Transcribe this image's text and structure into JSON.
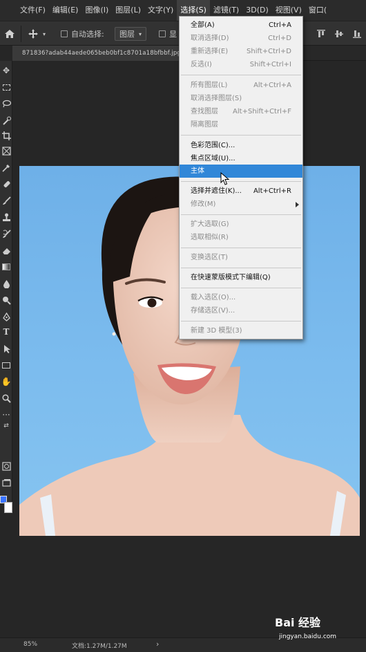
{
  "menubar": {
    "items": [
      "文件(F)",
      "编辑(E)",
      "图像(I)",
      "图层(L)",
      "文字(Y)",
      "选择(S)",
      "滤镜(T)",
      "3D(D)",
      "视图(V)",
      "窗口("
    ],
    "active_index": 5
  },
  "options": {
    "auto_select_label": "自动选择:",
    "layer_select_value": "图层",
    "truncated_label": "显"
  },
  "document": {
    "tab_title": "871836?adab44aede065beb0bf1c8701a18bfbbf.jpg"
  },
  "select_menu": {
    "groups": [
      [
        {
          "label": "全部(A)",
          "shortcut": "Ctrl+A",
          "enabled": true
        },
        {
          "label": "取消选择(D)",
          "shortcut": "Ctrl+D",
          "enabled": false
        },
        {
          "label": "重新选择(E)",
          "shortcut": "Shift+Ctrl+D",
          "enabled": false
        },
        {
          "label": "反选(I)",
          "shortcut": "Shift+Ctrl+I",
          "enabled": false
        }
      ],
      [
        {
          "label": "所有图层(L)",
          "shortcut": "Alt+Ctrl+A",
          "enabled": false
        },
        {
          "label": "取消选择图层(S)",
          "shortcut": "",
          "enabled": false
        },
        {
          "label": "查找图层",
          "shortcut": "Alt+Shift+Ctrl+F",
          "enabled": false
        },
        {
          "label": "隔离图层",
          "shortcut": "",
          "enabled": false
        }
      ],
      [
        {
          "label": "色彩范围(C)...",
          "shortcut": "",
          "enabled": true
        },
        {
          "label": "焦点区域(U)...",
          "shortcut": "",
          "enabled": true
        },
        {
          "label": "主体",
          "shortcut": "",
          "enabled": true,
          "highlighted": true
        }
      ],
      [
        {
          "label": "选择并遮住(K)...",
          "shortcut": "Alt+Ctrl+R",
          "enabled": true
        },
        {
          "label": "修改(M)",
          "shortcut": "",
          "enabled": false,
          "submenu": true
        }
      ],
      [
        {
          "label": "扩大选取(G)",
          "shortcut": "",
          "enabled": false
        },
        {
          "label": "选取相似(R)",
          "shortcut": "",
          "enabled": false
        }
      ],
      [
        {
          "label": "变换选区(T)",
          "shortcut": "",
          "enabled": false
        }
      ],
      [
        {
          "label": "在快速蒙版模式下编辑(Q)",
          "shortcut": "",
          "enabled": true
        }
      ],
      [
        {
          "label": "载入选区(O)...",
          "shortcut": "",
          "enabled": false
        },
        {
          "label": "存储选区(V)...",
          "shortcut": "",
          "enabled": false
        }
      ],
      [
        {
          "label": "新建 3D 模型(3)",
          "shortcut": "",
          "enabled": false
        }
      ]
    ]
  },
  "status": {
    "zoom": "85%",
    "doc_size": "文档:1.27M/1.27M",
    "arrow": "›"
  },
  "watermark": {
    "logo": "Bai 经验",
    "url": "jingyan.baidu.com"
  },
  "colors": {
    "highlight": "#3187d8",
    "foreground_swatch": "#3a74ff",
    "background_swatch": "#ffffff",
    "canvas_bg": "#7cbcee"
  },
  "tools": [
    "move-tool-icon",
    "marquee-tool-icon",
    "lasso-tool-icon",
    "quick-select-tool-icon",
    "crop-tool-icon",
    "frame-tool-icon",
    "eyedropper-tool-icon",
    "healing-brush-icon",
    "brush-tool-icon",
    "clone-stamp-icon",
    "history-brush-icon",
    "eraser-tool-icon",
    "gradient-tool-icon",
    "blur-tool-icon",
    "dodge-tool-icon",
    "pen-tool-icon",
    "type-tool-icon",
    "path-select-icon",
    "rectangle-tool-icon",
    "hand-tool-icon",
    "zoom-tool-icon",
    "more-tools-icon"
  ]
}
